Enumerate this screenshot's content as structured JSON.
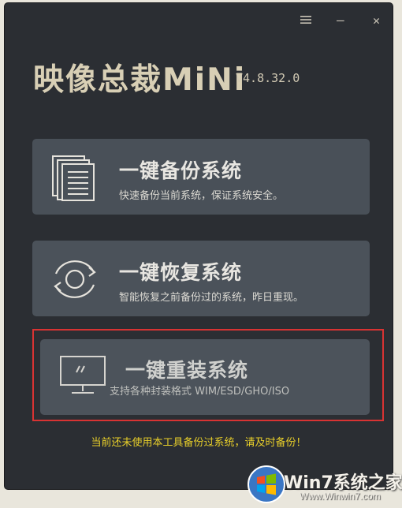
{
  "window": {
    "menu_icon": "menu-icon",
    "minimize_symbol": "—",
    "close_symbol": "✕",
    "title": "映像总裁MiNi",
    "version": "V4.8.32.0"
  },
  "cards": [
    {
      "title": "一键备份系统",
      "description": "快速备份当前系统，保证系统安全。",
      "icon": "documents-icon"
    },
    {
      "title": "一键恢复系统",
      "description": "智能恢复之前备份过的系统，昨日重现。",
      "icon": "restore-cycle-icon"
    },
    {
      "title": "一键重装系统",
      "description": "支持各种封装格式 WIM/ESD/GHO/ISO",
      "icon": "monitor-icon"
    }
  ],
  "notice": "当前还未使用本工具备份过系统，请及时备份！",
  "watermark": {
    "brand": "Win7系统之家",
    "url": "Www.Winwin7.com"
  },
  "colors": {
    "window_bg": "#2b2e33",
    "card_bg": "#495058",
    "notice": "#e8cf2a",
    "highlight": "#d83333",
    "title": "#d8cfb5"
  }
}
